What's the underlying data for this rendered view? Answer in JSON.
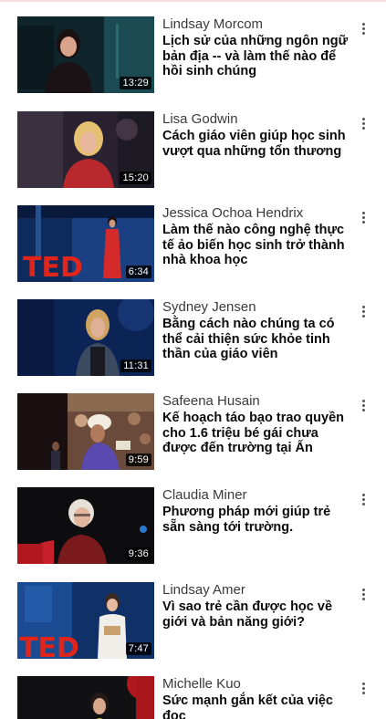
{
  "videos": [
    {
      "speaker": "Lindsay Morcom",
      "title": "Lịch sử của những ngôn ngữ bản địa -- và làm thế nào để hồi sinh chúng",
      "duration": "13:29"
    },
    {
      "speaker": "Lisa Godwin",
      "title": "Cách giáo viên giúp học sinh vượt qua những tổn thương",
      "duration": "15:20"
    },
    {
      "speaker": "Jessica Ochoa Hendrix",
      "title": "Làm thế nào công nghệ thực tế ảo biến học sinh trở thành nhà khoa học",
      "duration": "6:34"
    },
    {
      "speaker": "Sydney Jensen",
      "title": "Bằng cách nào chúng ta có thể cải thiện sức khỏe tinh thần của giáo viên",
      "duration": "11:31"
    },
    {
      "speaker": "Safeena Husain",
      "title": "Kế hoạch táo bạo trao quyền cho 1.6 triệu bé gái chưa được đến trường tại Ấn",
      "duration": "9:59"
    },
    {
      "speaker": "Claudia Miner",
      "title": "Phương pháp mới giúp trẻ sẵn sàng tới trường.",
      "duration": "9:36"
    },
    {
      "speaker": "Lindsay Amer",
      "title": "Vì sao trẻ cần được học về giới và bản năng giới?",
      "duration": "7:47"
    },
    {
      "speaker": "Michelle Kuo",
      "title": "Sức mạnh gắn kết của việc đọc",
      "duration": ""
    }
  ],
  "icons": {
    "more": "more-vertical-icon"
  }
}
